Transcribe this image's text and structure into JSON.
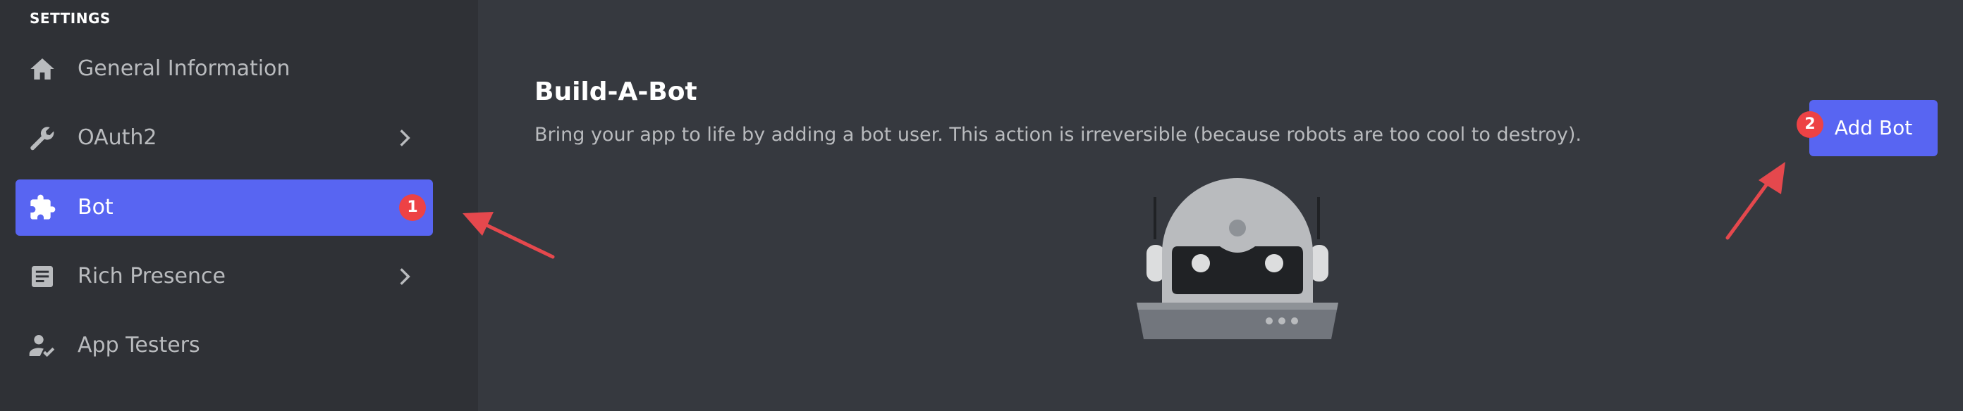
{
  "sidebar": {
    "section_header": "SETTINGS",
    "items": [
      {
        "label": "General Information",
        "icon": "home-icon",
        "has_chevron": false,
        "active": false
      },
      {
        "label": "OAuth2",
        "icon": "wrench-icon",
        "has_chevron": true,
        "active": false
      },
      {
        "label": "Bot",
        "icon": "puzzle-icon",
        "has_chevron": false,
        "active": true,
        "badge": "1"
      },
      {
        "label": "Rich Presence",
        "icon": "document-icon",
        "has_chevron": true,
        "active": false
      },
      {
        "label": "App Testers",
        "icon": "user-check-icon",
        "has_chevron": false,
        "active": false
      }
    ]
  },
  "main": {
    "title": "Build-A-Bot",
    "description": "Bring your app to life by adding a bot user. This action is irreversible (because robots are too cool to destroy).",
    "add_bot_label": "Add Bot",
    "add_bot_badge": "2"
  },
  "colors": {
    "background": "#36393f",
    "sidebar": "#2f3136",
    "accent": "#5865f2",
    "badge": "#ed4245",
    "annotation_arrow": "#e5484d"
  }
}
